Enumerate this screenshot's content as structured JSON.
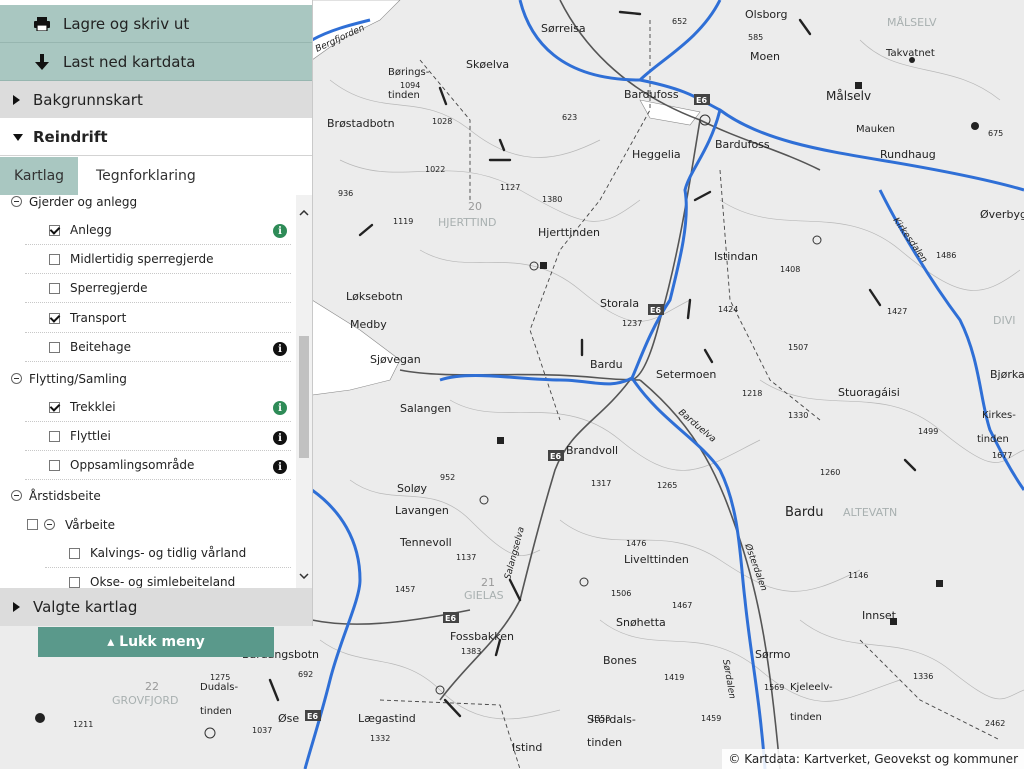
{
  "toolbar": {
    "print_label": "Lagre og skriv ut",
    "download_label": "Last ned kartdata"
  },
  "sections": {
    "background_label": "Bakgrunnskart",
    "reindrift_label": "Reindrift",
    "selected_label": "Valgte kartlag"
  },
  "tabs": {
    "layers_label": "Kartlag",
    "legend_label": "Tegnforklaring"
  },
  "layers": {
    "group1": "Gjerder og anlegg",
    "anlegg": "Anlegg",
    "midlertidig": "Midlertidig sperregjerde",
    "sperregjerde": "Sperregjerde",
    "transport": "Transport",
    "beitehage": "Beitehage",
    "group2": "Flytting/Samling",
    "trekklei": "Trekklei",
    "flyttlei": "Flyttlei",
    "oppsamling": "Oppsamlingsområde",
    "group3": "Årstidsbeite",
    "varbeite": "Vårbeite",
    "kalving": "Kalvings- og tidlig vårland",
    "okse": "Okse- og simlebeiteland"
  },
  "close_menu_label": "▴ Lukk meny",
  "attribution": {
    "prefix": "© Kartdata:",
    "text": "Kartverket, Geovekst og kommuner"
  },
  "colors": {
    "toolbar_bg": "#a9c7c1",
    "close_button": "#5a998b",
    "info_green": "#2e8b57",
    "info_black": "#111111",
    "boundary_blue": "#2f6fd6"
  },
  "map": {
    "places": [
      "Sørreisa",
      "Olsborg",
      "MÅLSELV",
      "Takvatnet",
      "Moen",
      "Målselv",
      "Børings-",
      "tinden",
      "Skøelva",
      "Bardufoss",
      "Mauken",
      "Rundhaug",
      "Brøstadbotn",
      "Heggelia",
      "Bardufoss",
      "Øverbygd",
      "HJERTTIND",
      "Hjerttinden",
      "Istindan",
      "Kirkesdalen",
      "DIVI",
      "Løksebotn",
      "Storala",
      "Medby",
      "Sjøvegan",
      "Bardu",
      "Setermoen",
      "Stuoragáisi",
      "Bjørka",
      "Salangen",
      "Brandvoll",
      "Kirkes-",
      "tinden",
      "Soløy",
      "Lavangen",
      "Bardu",
      "ALTEVATN",
      "Tennevoll",
      "Livelttinden",
      "Salangselva",
      "GIELAS",
      "Østerdalen",
      "Fossbakken",
      "Snøhetta",
      "Innset",
      "Bones",
      "Sørmo",
      "Kjeleelv-",
      "tinden",
      "Stordals-",
      "tinden",
      "Istind",
      "Lægastind",
      "Dudals-",
      "tinden",
      "GROVFJORD",
      "Bardangsbotn",
      "Øse",
      "Bardelva",
      "Sørdalen",
      "Bergfjorden"
    ],
    "elevations": [
      "652",
      "585",
      "675",
      "1094",
      "623",
      "1028",
      "1022",
      "1127",
      "1380",
      "936",
      "1119",
      "1408",
      "1486",
      "1424",
      "1237",
      "1427",
      "1507",
      "1218",
      "1330",
      "1499",
      "1677",
      "1260",
      "952",
      "1317",
      "1265",
      "1146",
      "1137",
      "1476",
      "1457",
      "1506",
      "1467",
      "1383",
      "1336",
      "1275",
      "1211",
      "692",
      "1037",
      "1332",
      "1358",
      "1419",
      "1569",
      "1459",
      "2462",
      "20",
      "21",
      "22"
    ],
    "roads": [
      "E6",
      "E6",
      "E6",
      "E6",
      "E6"
    ]
  }
}
